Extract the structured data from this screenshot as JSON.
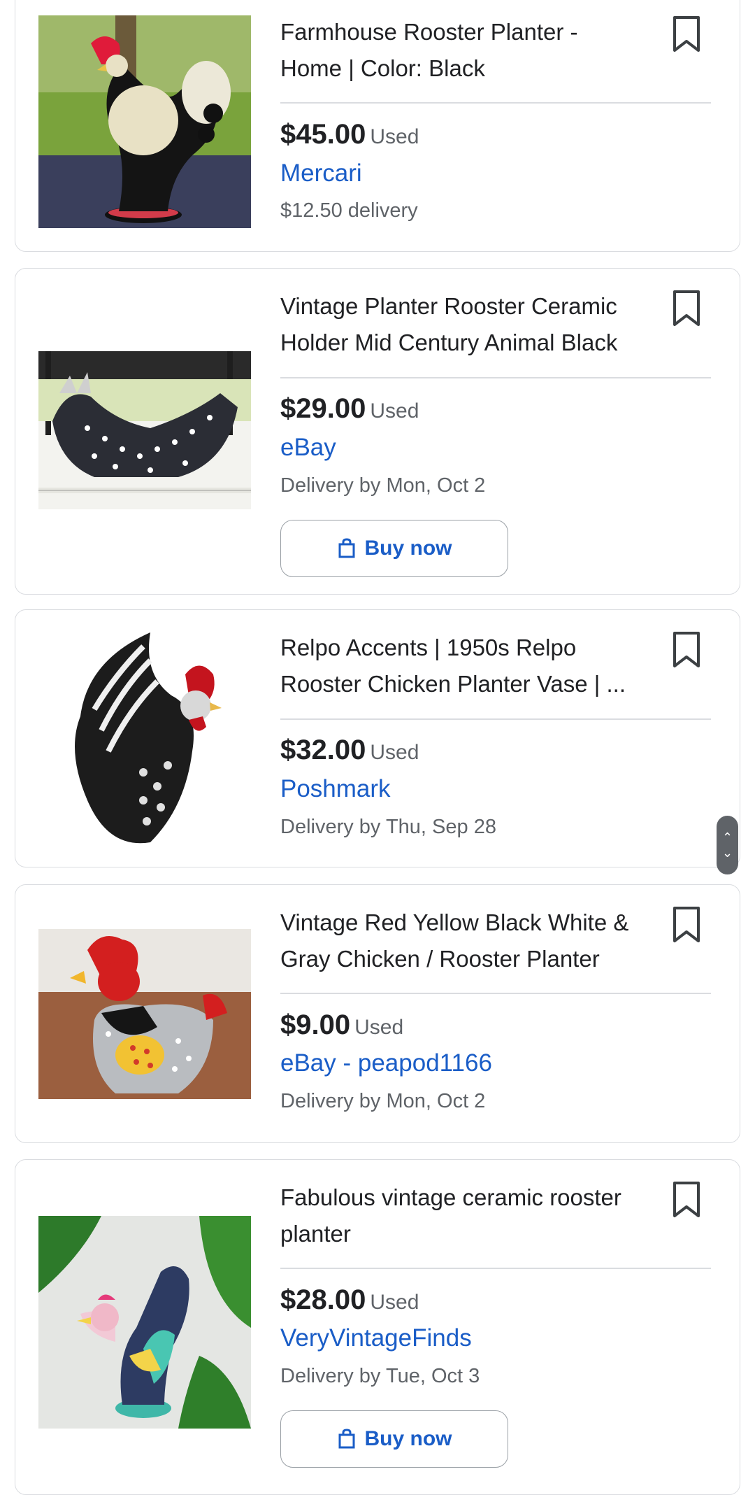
{
  "listings": [
    {
      "title_line1": "Farmhouse Rooster Planter -",
      "title_line2": "Home | Color: Black",
      "price": "$45.00",
      "condition": "Used",
      "seller": "Mercari",
      "delivery": "$12.50 delivery",
      "bookmark_icon": "bookmark-outline-icon"
    },
    {
      "title_line1": "Vintage Planter Rooster Ceramic",
      "title_line2": "Holder Mid Century Animal Black",
      "price": "$29.00",
      "condition": "Used",
      "seller": "eBay",
      "delivery": "Delivery by Mon, Oct 2",
      "buy_label": "Buy now",
      "buy_icon": "shopping-bag-icon"
    },
    {
      "title_line1": "Relpo Accents | 1950s Relpo",
      "title_line2": "Rooster Chicken Planter Vase | ...",
      "price": "$32.00",
      "condition": "Used",
      "seller": "Poshmark",
      "delivery": "Delivery by Thu, Sep 28"
    },
    {
      "title_line1": "Vintage Red Yellow Black White &",
      "title_line2": "Gray Chicken / Rooster Planter",
      "price": "$9.00",
      "condition": "Used",
      "seller": "eBay - peapod1166",
      "delivery": "Delivery by Mon, Oct 2"
    },
    {
      "title_line1": "Fabulous vintage ceramic rooster",
      "title_line2": "planter",
      "price": "$28.00",
      "condition": "Used",
      "seller": "VeryVintageFinds",
      "delivery": "Delivery by Tue, Oct 3",
      "buy_label": "Buy now",
      "buy_icon": "shopping-bag-icon"
    }
  ],
  "colors": {
    "link": "#1a5dc7",
    "text": "#202124",
    "muted": "#5f6368",
    "border": "#dadce0"
  }
}
